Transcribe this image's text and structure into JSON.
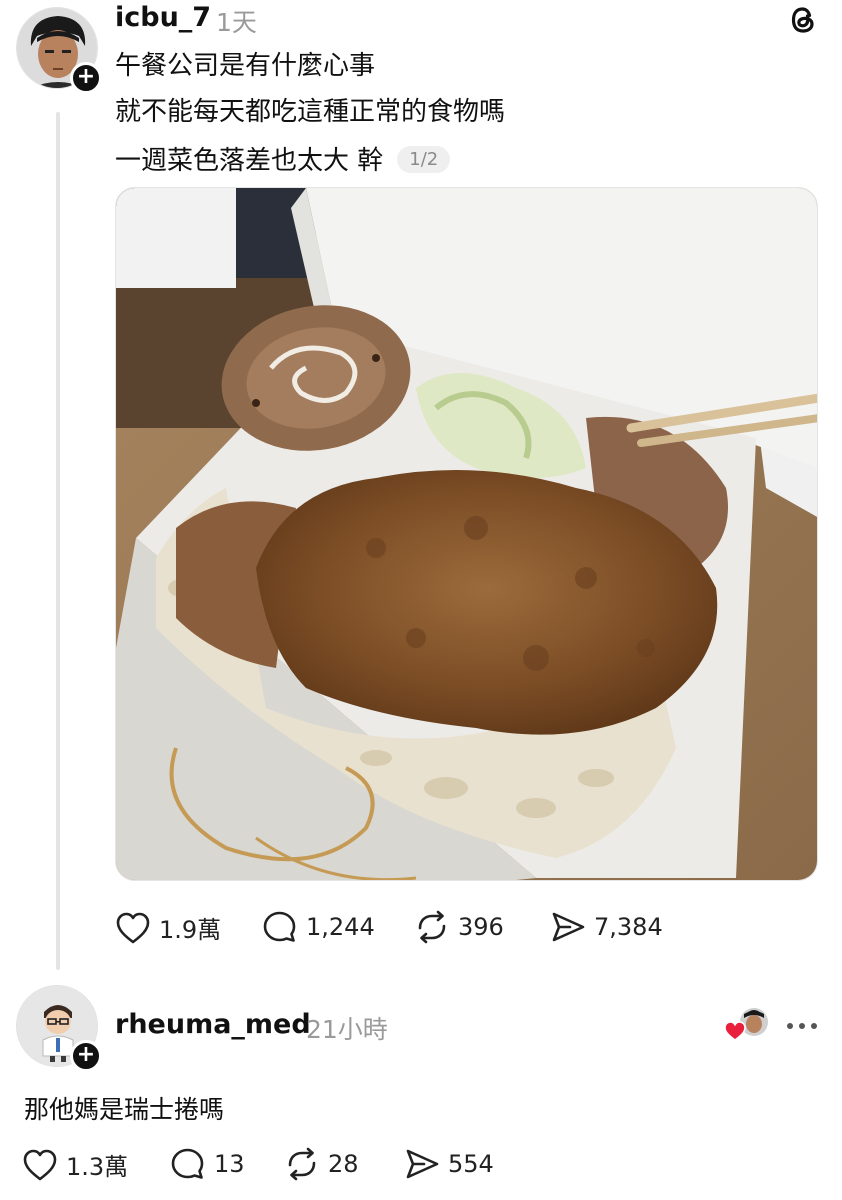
{
  "post": {
    "username": "icbu_7",
    "time": "1天",
    "lines": [
      "午餐公司是有什麼心事",
      "就不能每天都吃這種正常的食物嗎",
      "一週菜色落差也太大 幹"
    ],
    "page_indicator": "1/2",
    "stats": {
      "likes": "1.9萬",
      "replies": "1,244",
      "reposts": "396",
      "shares": "7,384"
    }
  },
  "reply": {
    "username": "rheuma_med",
    "time": "21小時",
    "text": "那他媽是瑞士捲嗎",
    "stats": {
      "likes": "1.3萬",
      "replies": "13",
      "reposts": "28",
      "shares": "554"
    }
  },
  "icons": {
    "app_logo": "threads-logo-icon",
    "follow": "plus-icon",
    "like": "heart-icon",
    "reply": "comment-bubble-icon",
    "repost": "repost-arrows-icon",
    "share": "send-icon",
    "more": "more-options-icon"
  },
  "colors": {
    "text": "#111111",
    "muted": "#9a9a9a",
    "heart_accent": "#e8203e",
    "divider": "#e4e4e4"
  }
}
